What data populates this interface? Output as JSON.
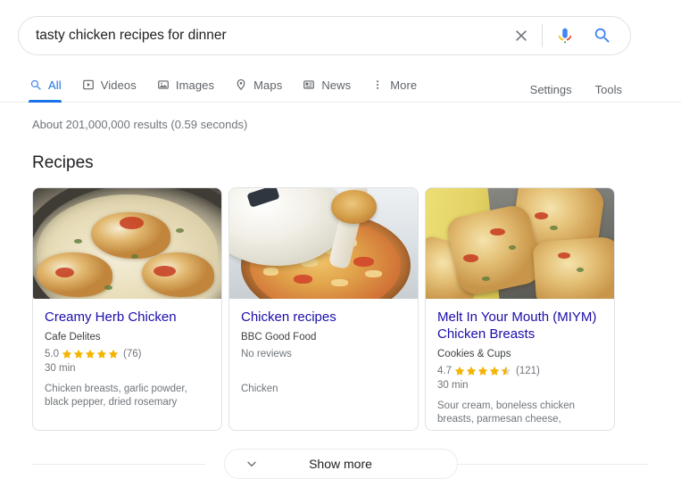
{
  "search": {
    "query": "tasty chicken recipes for dinner",
    "placeholder": "Search",
    "clear_label": "Clear",
    "mic_label": "Search by voice",
    "search_label": "Google Search"
  },
  "nav": {
    "tabs": [
      {
        "label": "All",
        "icon": "search-icon",
        "active": true
      },
      {
        "label": "Videos",
        "icon": "video-icon",
        "active": false
      },
      {
        "label": "Images",
        "icon": "image-icon",
        "active": false
      },
      {
        "label": "Maps",
        "icon": "map-pin-icon",
        "active": false
      },
      {
        "label": "News",
        "icon": "news-icon",
        "active": false
      },
      {
        "label": "More",
        "icon": "more-vertical-icon",
        "active": false
      }
    ],
    "settings_label": "Settings",
    "tools_label": "Tools"
  },
  "results": {
    "stats": "About 201,000,000 results (0.59 seconds)"
  },
  "recipes": {
    "heading": "Recipes",
    "cards": [
      {
        "title": "Creamy Herb Chicken",
        "source": "Cafe Delites",
        "rating": "5.0",
        "stars": 5,
        "reviews": "(76)",
        "no_reviews": "",
        "time": "30 min",
        "ingredients": "Chicken breasts, garlic powder, black pepper, dried rosemary"
      },
      {
        "title": "Chicken recipes",
        "source": "BBC Good Food",
        "rating": "",
        "stars": 0,
        "reviews": "",
        "no_reviews": "No reviews",
        "time": "",
        "ingredients": "Chicken"
      },
      {
        "title": "Melt In Your Mouth (MIYM) Chicken Breasts",
        "source": "Cookies & Cups",
        "rating": "4.7",
        "stars": 4.5,
        "reviews": "(121)",
        "no_reviews": "",
        "time": "30 min",
        "ingredients": "Sour cream, boneless chicken breasts, parmesan cheese,"
      }
    ]
  },
  "show_more": {
    "label": "Show more",
    "icon": "chevron-down-icon"
  },
  "colors": {
    "link_blue": "#1a0dab",
    "active_blue": "#1a73e8",
    "star_gold": "#f5b400",
    "text_gray": "#70757a",
    "border_gray": "#dfe1e5"
  }
}
